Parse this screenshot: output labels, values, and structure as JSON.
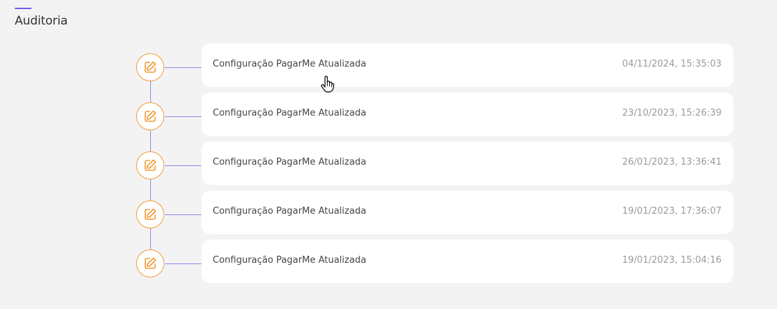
{
  "section": {
    "title": "Auditoria"
  },
  "colors": {
    "accent": "#6c5ce7",
    "timeline_line": "#8f85e6",
    "icon_orange": "#f39a34"
  },
  "audit_entries": [
    {
      "description": "Configuração PagarMe Atualizada",
      "datetime": "04/11/2024, 15:35:03",
      "icon": "edit-icon"
    },
    {
      "description": "Configuração PagarMe Atualizada",
      "datetime": "23/10/2023, 15:26:39",
      "icon": "edit-icon"
    },
    {
      "description": "Configuração PagarMe Atualizada",
      "datetime": "26/01/2023, 13:36:41",
      "icon": "edit-icon"
    },
    {
      "description": "Configuração PagarMe Atualizada",
      "datetime": "19/01/2023, 17:36:07",
      "icon": "edit-icon"
    },
    {
      "description": "Configuração PagarMe Atualizada",
      "datetime": "19/01/2023, 15:04:16",
      "icon": "edit-icon"
    }
  ]
}
